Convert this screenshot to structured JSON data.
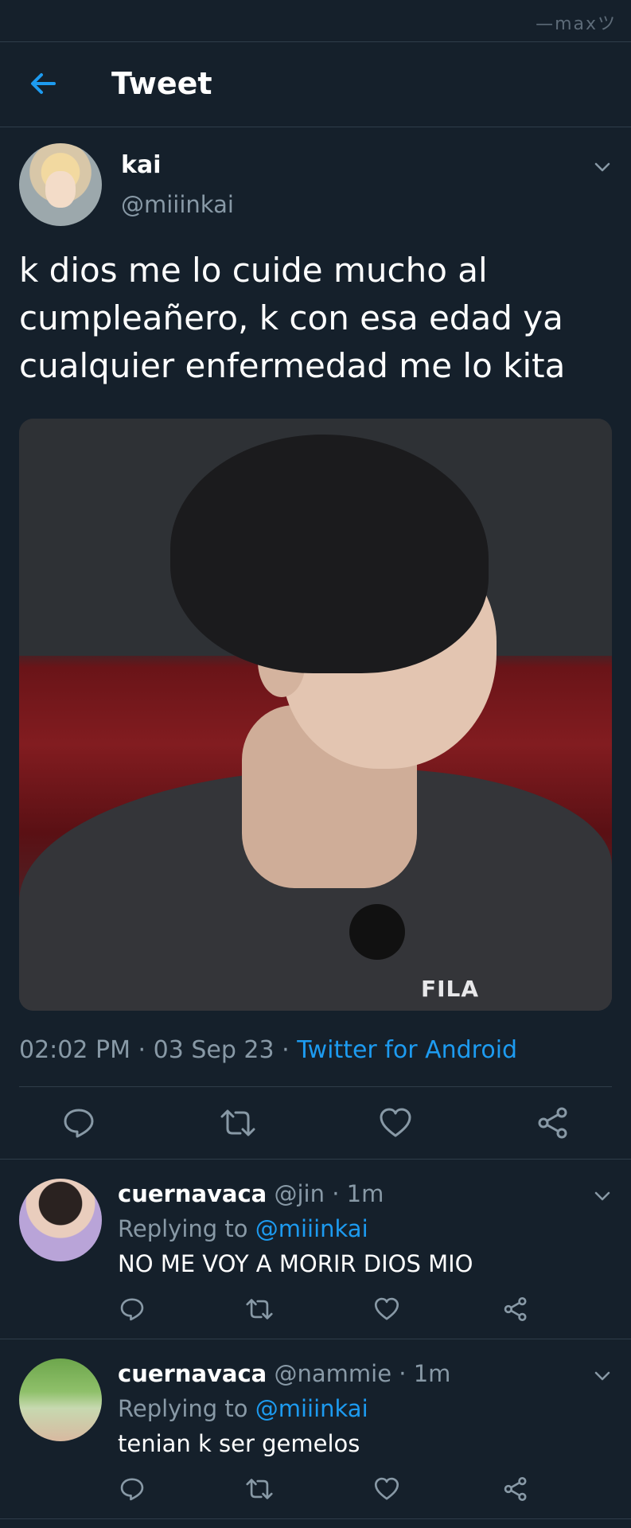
{
  "watermark": "—maxツ",
  "header": {
    "title": "Tweet"
  },
  "tweet": {
    "author_name": "kai",
    "author_handle": "@miiinkai",
    "text": "k dios me lo cuide mucho al cumpleañero, k con esa edad ya cualquier enfermedad me lo kita",
    "image_logo_text": "FILA",
    "time": "02:02 PM",
    "date": "03 Sep 23",
    "separator": "·",
    "source": "Twitter for Android"
  },
  "replies": [
    {
      "name": "cuernavaca",
      "handle": "@jin",
      "time": "1m",
      "separator": "·",
      "replying_label": "Replying to",
      "replying_to": "@miiinkai",
      "text": "NO ME VOY A MORIR DIOS MIO"
    },
    {
      "name": "cuernavaca",
      "handle": "@nammie",
      "time": "1m",
      "separator": "·",
      "replying_label": "Replying to",
      "replying_to": "@miiinkai",
      "text": "tenian k ser gemelos"
    }
  ],
  "icons": [
    "back-arrow-icon",
    "chevron-down-icon",
    "reply-icon",
    "retweet-icon",
    "like-icon",
    "share-icon"
  ],
  "colors": {
    "background": "#15202b",
    "accent": "#1d9bf0",
    "secondary_text": "#8899a6",
    "divider": "#2f3d4a"
  }
}
